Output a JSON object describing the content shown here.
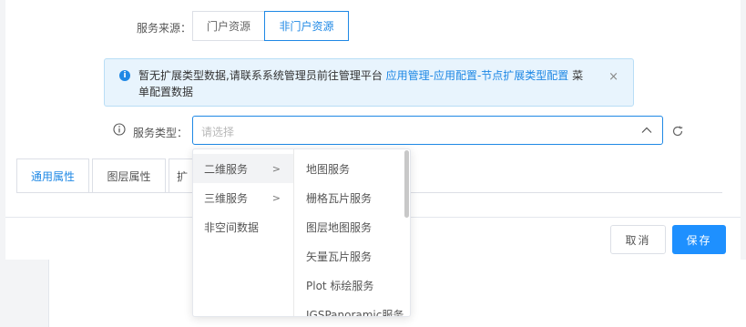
{
  "source": {
    "label": "服务来源：",
    "options": [
      "门户资源",
      "非门户资源"
    ],
    "selected": "非门户资源"
  },
  "alert": {
    "text_before": "暂无扩展类型数据,请联系系统管理员前往管理平台 ",
    "link": "应用管理-应用配置-节点扩展类型配置",
    "text_after": " 菜单配置数据",
    "close": "×"
  },
  "service_type": {
    "label": "服务类型：",
    "placeholder": "请选择"
  },
  "tabs": [
    "通用属性",
    "图层属性",
    "扩"
  ],
  "buttons": {
    "cancel": "取消",
    "save": "保存"
  },
  "dropdown": {
    "level1": [
      {
        "label": "二维服务",
        "has_children": true,
        "selected": true
      },
      {
        "label": "三维服务",
        "has_children": true
      },
      {
        "label": "非空间数据",
        "has_children": false
      }
    ],
    "level2": [
      "地图服务",
      "栅格瓦片服务",
      "图层地图服务",
      "矢量瓦片服务",
      "Plot 标绘服务",
      "IGSPanoramic服务"
    ]
  },
  "colors": {
    "accent": "#1e88e5",
    "save_bg": "#1e90ff",
    "alert_bg": "#e8f4fd"
  }
}
